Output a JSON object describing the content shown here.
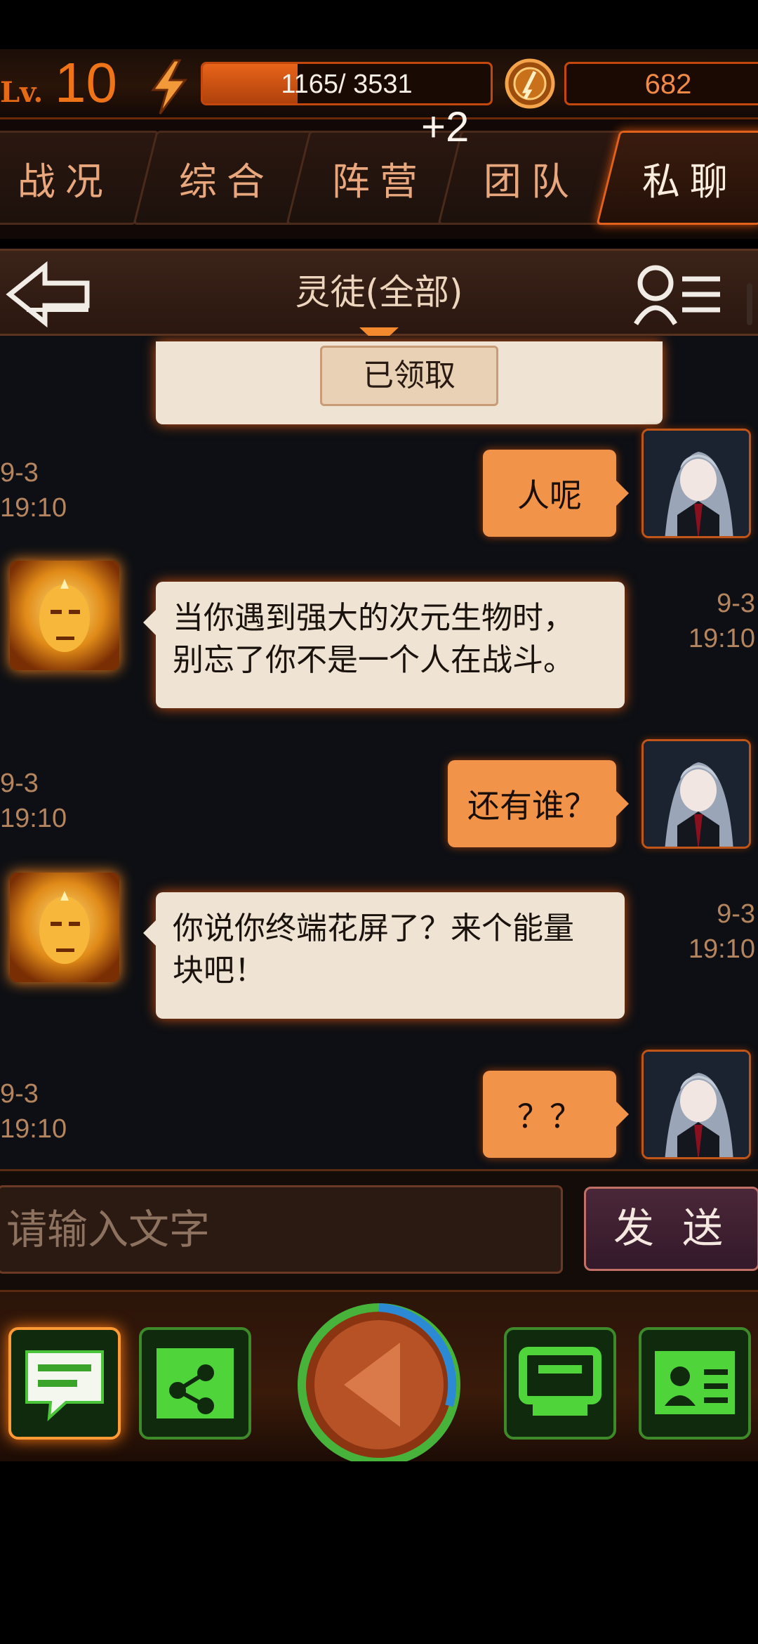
{
  "hud": {
    "level_label": "Lv.",
    "level_value": "10",
    "energy_text": "1165/ 3531",
    "energy_current": 1165,
    "energy_max": 3531,
    "currency_value": "682",
    "accent_color": "#ef7417"
  },
  "tabs": [
    {
      "label": "战况",
      "active": false
    },
    {
      "label": "综合",
      "active": false
    },
    {
      "label": "阵营",
      "active": false
    },
    {
      "label": "团队",
      "active": false
    },
    {
      "label": "私聊",
      "active": true
    }
  ],
  "badge": "+2",
  "chat_header": {
    "title": "灵徒(全部)"
  },
  "system_card": {
    "button_label": "已领取"
  },
  "messages": [
    {
      "side": "self",
      "text": "人呢",
      "date": "9-3",
      "time": "19:10"
    },
    {
      "side": "npc",
      "lines": [
        "当你遇到强大的次元生物时，",
        "别忘了你不是一个人在战斗。"
      ],
      "date": "9-3",
      "time": "19:10"
    },
    {
      "side": "self",
      "text": "还有谁？",
      "date": "9-3",
      "time": "19:10"
    },
    {
      "side": "npc",
      "lines": [
        "你说你终端花屏了？来个能量",
        "块吧！"
      ],
      "date": "9-3",
      "time": "19:10"
    },
    {
      "side": "self",
      "text": "？？",
      "date": "9-3",
      "time": "19:10"
    }
  ],
  "input": {
    "placeholder": "请输入文字",
    "send_label": "发送"
  },
  "bottom_nav": [
    {
      "icon": "chat-icon",
      "active": true
    },
    {
      "icon": "share-icon",
      "active": false
    },
    {
      "icon": "center-globe-icon",
      "active": false
    },
    {
      "icon": "terminal-icon",
      "active": false
    },
    {
      "icon": "contact-card-icon",
      "active": false
    }
  ]
}
